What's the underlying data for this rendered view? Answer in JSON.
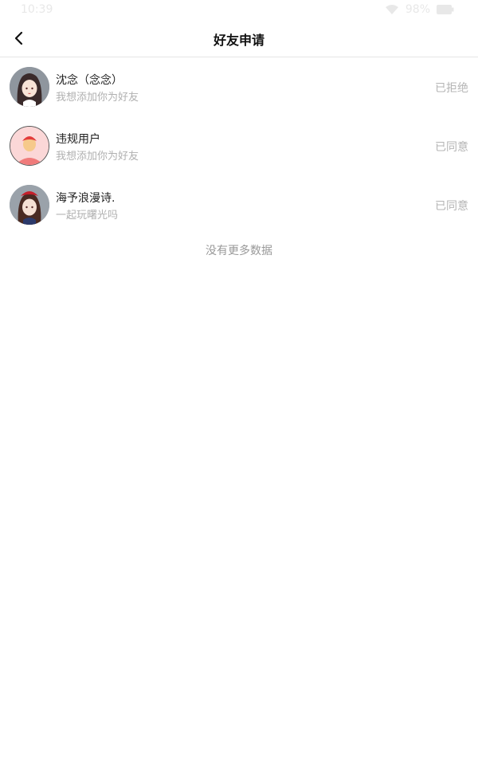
{
  "status_bar": {
    "time": "10:39",
    "battery": "98%",
    "wifi_icon": "wifi-icon",
    "battery_icon": "battery-icon"
  },
  "header": {
    "back_icon": "chevron-left-icon",
    "title": "好友申请"
  },
  "requests": [
    {
      "name": "沈念（念念）",
      "message": "我想添加你为好友",
      "status": "已拒绝",
      "avatar": "anime-girl-avatar"
    },
    {
      "name": "违规用户",
      "message": "我想添加你为好友",
      "status": "已同意",
      "avatar": "default-user-avatar"
    },
    {
      "name": "海予浪漫诗.",
      "message": "一起玩曙光吗",
      "status": "已同意",
      "avatar": "anime-girl-red-hat-avatar"
    }
  ],
  "footer": {
    "no_more": "没有更多数据"
  },
  "colors": {
    "status_text": "#b4b4b4",
    "divider": "#e6e6e6",
    "title": "#111111"
  }
}
